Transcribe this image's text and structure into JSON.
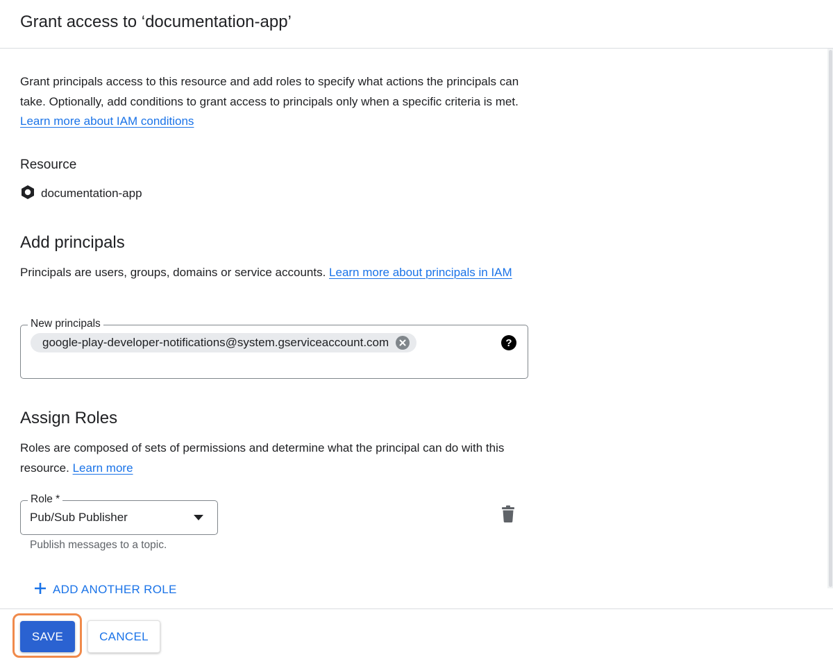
{
  "dialog": {
    "title": "Grant access to ‘documentation-app’"
  },
  "intro": {
    "text": "Grant principals access to this resource and add roles to specify what actions the principals can take. Optionally, add conditions to grant access to principals only when a specific criteria is met. ",
    "link": "Learn more about IAM conditions"
  },
  "resource": {
    "label": "Resource",
    "icon": "project-hexagon-icon",
    "name": "documentation-app"
  },
  "principals": {
    "heading": "Add principals",
    "description": "Principals are users, groups, domains or service accounts. ",
    "link": "Learn more about principals in IAM",
    "field_label": "New principals",
    "chip_value": "google-play-developer-notifications@system.gserviceaccount.com"
  },
  "roles": {
    "heading": "Assign Roles",
    "description": "Roles are composed of sets of permissions and determine what the principal can do with this resource. ",
    "link": "Learn more",
    "field_label": "Role *",
    "selected_role": "Pub/Sub Publisher",
    "helper_text": "Publish messages to a topic.",
    "add_another_label": "ADD ANOTHER ROLE"
  },
  "footer": {
    "save_label": "SAVE",
    "cancel_label": "CANCEL"
  },
  "colors": {
    "accent": "#1a73e8",
    "save_button": "#2a62d1",
    "highlight": "#f08a4b"
  }
}
